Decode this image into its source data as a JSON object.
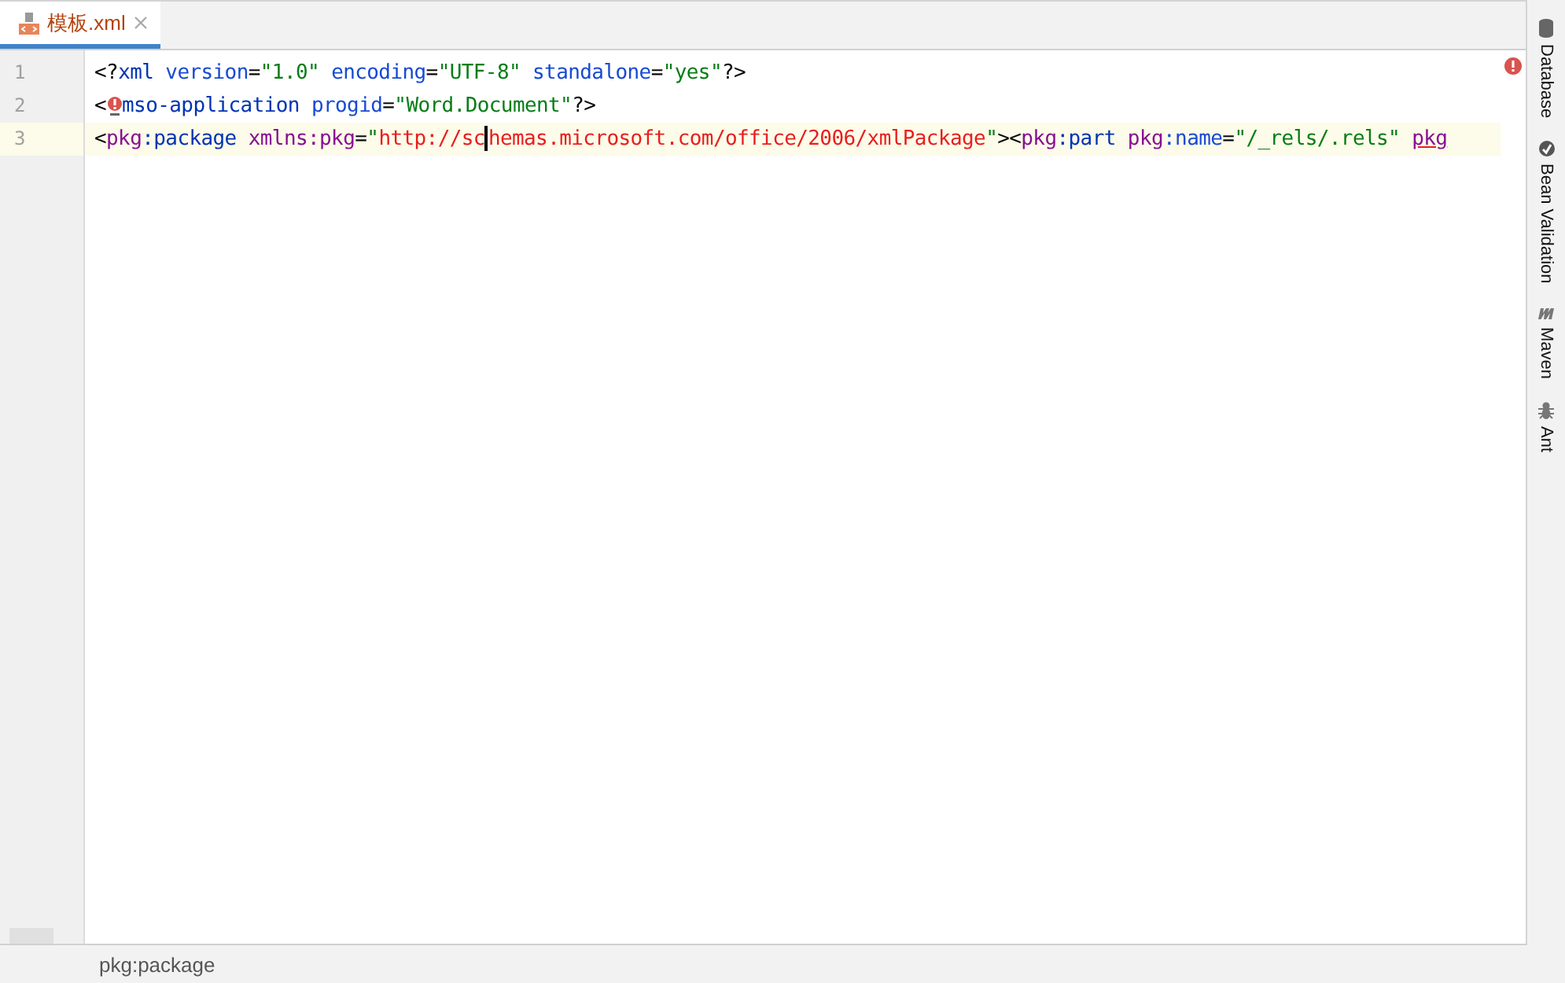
{
  "tabs": [
    {
      "label": "模板.xml",
      "selected": true
    }
  ],
  "editor": {
    "lines": [
      {
        "number": "1",
        "current": false,
        "tokens": [
          {
            "t": "<?",
            "kind": "punct"
          },
          {
            "t": "xml ",
            "kind": "tag"
          },
          {
            "t": "version",
            "kind": "attr"
          },
          {
            "t": "=",
            "kind": "punct"
          },
          {
            "t": "\"1.0\" ",
            "kind": "value"
          },
          {
            "t": "encoding",
            "kind": "attr"
          },
          {
            "t": "=",
            "kind": "punct"
          },
          {
            "t": "\"UTF-8\" ",
            "kind": "value"
          },
          {
            "t": "standalone",
            "kind": "attr"
          },
          {
            "t": "=",
            "kind": "punct"
          },
          {
            "t": "\"yes\"",
            "kind": "value"
          },
          {
            "t": "?>",
            "kind": "punct"
          }
        ]
      },
      {
        "number": "2",
        "current": false,
        "error_marker": true,
        "tokens": [
          {
            "t": "<",
            "kind": "punct"
          },
          {
            "t": "mso-application ",
            "kind": "tag"
          },
          {
            "t": "progid",
            "kind": "attr"
          },
          {
            "t": "=",
            "kind": "punct"
          },
          {
            "t": "\"Word.Document\"",
            "kind": "value"
          },
          {
            "t": "?>",
            "kind": "punct"
          }
        ]
      },
      {
        "number": "3",
        "current": true,
        "tokens": [
          {
            "t": "<",
            "kind": "punct"
          },
          {
            "t": "pkg",
            "kind": "ns"
          },
          {
            "t": ":package ",
            "kind": "tag"
          },
          {
            "t": "xmlns:pkg",
            "kind": "ns"
          },
          {
            "t": "=",
            "kind": "punct"
          },
          {
            "t": "\"",
            "kind": "value"
          },
          {
            "t": "http://schemas.microsoft.com/office/2006/xmlPackage",
            "kind": "url"
          },
          {
            "t": "\"",
            "kind": "value"
          },
          {
            "t": "><",
            "kind": "punct"
          },
          {
            "t": "pkg",
            "kind": "ns"
          },
          {
            "t": ":part ",
            "kind": "tag"
          },
          {
            "t": "pkg",
            "kind": "ns"
          },
          {
            "t": ":name",
            "kind": "attr"
          },
          {
            "t": "=",
            "kind": "punct"
          },
          {
            "t": "\"/_rels/.rels\" ",
            "kind": "value"
          },
          {
            "t": "pkg",
            "kind": "nserr"
          }
        ]
      }
    ]
  },
  "side_tools": [
    {
      "label": "Database",
      "kind": "database"
    },
    {
      "label": "Bean Validation",
      "kind": "bean"
    },
    {
      "label": "Maven",
      "kind": "maven"
    },
    {
      "label": "Ant",
      "kind": "ant"
    }
  ],
  "status_bar": {
    "breadcrumb": "pkg:package"
  }
}
